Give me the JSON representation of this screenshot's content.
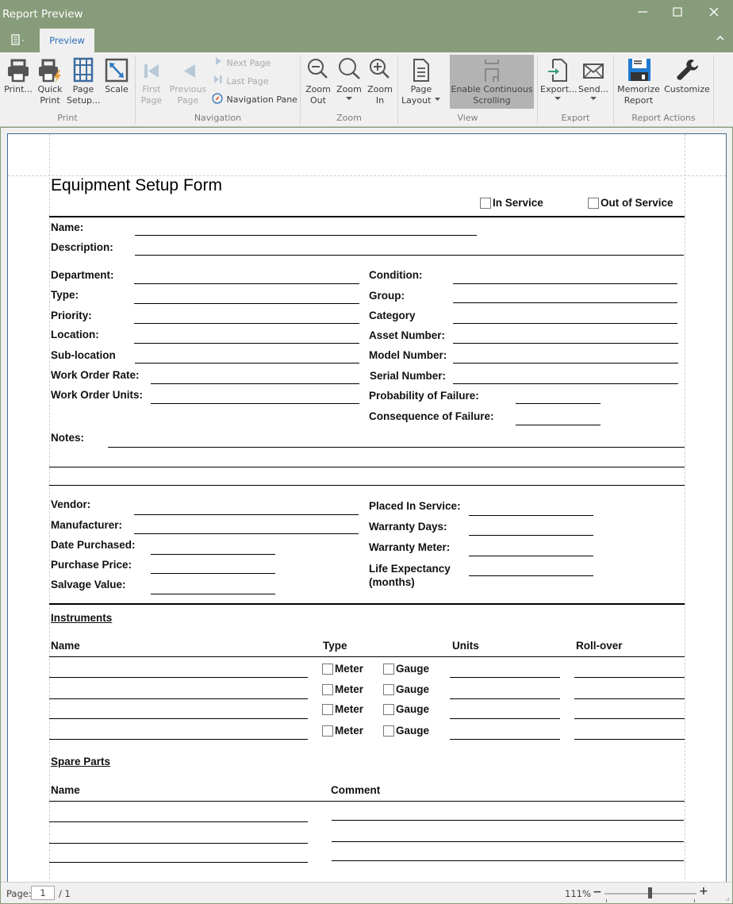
{
  "window": {
    "title": "Report Preview",
    "controls": {
      "minimize": "—",
      "maximize": "☐",
      "close": "✕"
    }
  },
  "ribbon": {
    "app_menu_icon": "▤·",
    "tabs": [
      {
        "label": "Preview",
        "active": true
      }
    ],
    "collapse_icon": "⌃",
    "groups": {
      "print": {
        "label": "Print",
        "buttons": [
          {
            "label": "Print...",
            "icon": "printer-icon"
          },
          {
            "label": "Quick Print",
            "icon": "quick-print-icon"
          },
          {
            "label": "Page Setup...",
            "icon": "page-setup-icon"
          },
          {
            "label": "Scale",
            "icon": "scale-icon"
          }
        ]
      },
      "navigation": {
        "label": "Navigation",
        "buttons": [
          {
            "label": "First Page",
            "icon": "first-page-icon",
            "enabled": false
          },
          {
            "label": "Previous Page",
            "icon": "previous-page-icon",
            "enabled": false
          },
          {
            "label": "Next Page",
            "icon": "next-page-icon",
            "enabled": false
          },
          {
            "label": "Last Page",
            "icon": "last-page-icon",
            "enabled": false
          },
          {
            "label": "Navigation Pane",
            "icon": "compass-icon",
            "enabled": true
          }
        ]
      },
      "zoom": {
        "label": "Zoom",
        "buttons": [
          {
            "label": "Zoom Out",
            "icon": "zoom-out-icon"
          },
          {
            "label": "Zoom",
            "icon": "zoom-icon"
          },
          {
            "label": "Zoom In",
            "icon": "zoom-in-icon"
          }
        ]
      },
      "view": {
        "label": "View",
        "buttons": [
          {
            "label": "Page Layout",
            "icon": "page-layout-icon"
          },
          {
            "label": "Enable Continuous Scrolling",
            "icon": "continuous-scroll-icon",
            "active": true
          }
        ]
      },
      "export": {
        "label": "Export",
        "buttons": [
          {
            "label": "Export...",
            "icon": "export-icon"
          },
          {
            "label": "Send...",
            "icon": "envelope-icon"
          }
        ]
      },
      "report_actions": {
        "label": "Report Actions",
        "buttons": [
          {
            "label": "Memorize Report",
            "icon": "floppy-disk-icon"
          },
          {
            "label": "Customize",
            "icon": "wrench-icon"
          }
        ]
      }
    }
  },
  "form": {
    "title": "Equipment Setup Form",
    "status_options": [
      {
        "label": "In Service",
        "checked": false
      },
      {
        "label": "Out of Service",
        "checked": false
      }
    ],
    "general": {
      "name": "Name:",
      "description": "Description:"
    },
    "left_fields": [
      "Department:",
      "Type:",
      "Priority:",
      "Location:",
      "Sub-location",
      "Work Order Rate:",
      "Work Order Units:"
    ],
    "right_fields": [
      "Condition:",
      "Group:",
      "Category",
      "Asset Number:",
      "Model Number:",
      "Serial Number:",
      "Probability of Failure:",
      "Consequence of Failure:"
    ],
    "notes_label": "Notes:",
    "purchase_left": [
      "Vendor:",
      "Manufacturer:",
      "Date Purchased:",
      "Purchase Price:",
      "Salvage Value:"
    ],
    "purchase_right": [
      "Placed In Service:",
      "Warranty Days:",
      "Warranty Meter:",
      "Life Expectancy",
      "(months)"
    ],
    "instruments": {
      "heading": "Instruments",
      "columns": [
        "Name",
        "Type",
        "Units",
        "Roll-over"
      ],
      "row_options": [
        "Meter",
        "Gauge"
      ],
      "row_count": 4
    },
    "spare_parts": {
      "heading": "Spare Parts",
      "columns": [
        "Name",
        "Comment"
      ],
      "row_count": 3
    }
  },
  "status_bar": {
    "page_label": "Page:",
    "current_page": "1",
    "total_pages": "/ 1",
    "zoom_level": "111%",
    "zoom_slider_fraction": 0.49
  },
  "colors": {
    "title_bar": "#879c7a",
    "ribbon_bg": "#f0f0f0",
    "accent_blue": "#2e6fb7",
    "active_button": "#b3b3b3"
  }
}
